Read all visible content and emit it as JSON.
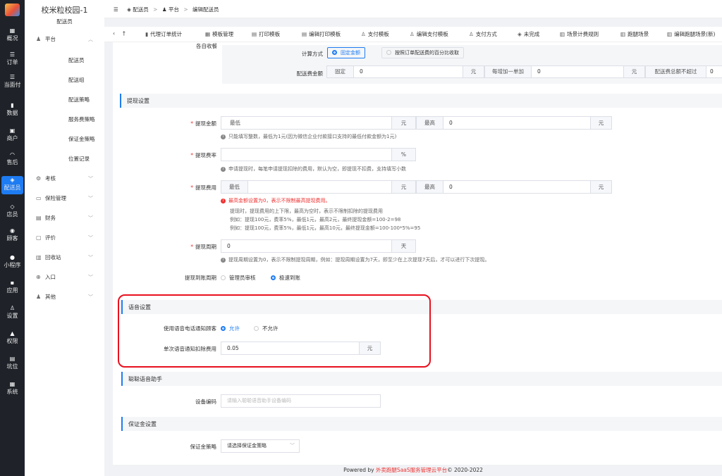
{
  "leftnav": {
    "items": [
      {
        "icon": "grid-icon",
        "glyph": "▦",
        "label": "概况"
      },
      {
        "icon": "list-icon",
        "glyph": "☰",
        "label": "订单"
      },
      {
        "icon": "pay-icon",
        "glyph": "☰",
        "label": "当面付"
      },
      {
        "icon": "bar-chart-icon",
        "glyph": "▮",
        "label": "数据"
      },
      {
        "icon": "store-icon",
        "glyph": "▣",
        "label": "商户"
      },
      {
        "icon": "headset-icon",
        "glyph": "◠",
        "label": "售后"
      },
      {
        "icon": "courier-icon",
        "glyph": "◈",
        "label": "配送员"
      },
      {
        "icon": "shop-icon",
        "glyph": "◇",
        "label": "店员"
      },
      {
        "icon": "customer-icon",
        "glyph": "◉",
        "label": "顾客"
      },
      {
        "icon": "mini-program-icon",
        "glyph": "●",
        "label": "小程序"
      },
      {
        "icon": "apps-icon",
        "glyph": "▪",
        "label": "应用"
      },
      {
        "icon": "settings-icon",
        "glyph": "♙",
        "label": "设置"
      },
      {
        "icon": "lock-icon",
        "glyph": "▲",
        "label": "权限"
      },
      {
        "icon": "document-icon",
        "glyph": "▤",
        "label": "坑位"
      },
      {
        "icon": "windows-icon",
        "glyph": "▦",
        "label": "系统"
      }
    ]
  },
  "sidebar": {
    "school": "校米粒校园-1",
    "role": "配送员",
    "platform": "平台",
    "sub_items": [
      "配送员",
      "配送组",
      "配送策略",
      "服务费策略",
      "保证金策略",
      "位置记录"
    ],
    "groups": [
      "考核",
      "保险管理",
      "财务",
      "评价",
      "回收站",
      "入口",
      "其他"
    ]
  },
  "breadcrumb": {
    "items": [
      "配送员",
      "平台",
      "编辑配送员"
    ]
  },
  "tabs": [
    "代理订单统计",
    "模板管理",
    "打印模板",
    "编辑打印模板",
    "支付模板",
    "编辑支付模板",
    "支付方式",
    "未完成",
    "场景计费规则",
    "跑腿场景",
    "编辑跑腿场景(新)"
  ],
  "collect": {
    "label": "各自收餐",
    "calc_label": "计算方式",
    "option_fixed": "固定金额",
    "option_percent": "按照订单配送费的百分比收取",
    "fee_label": "配送费金额",
    "fixed_label": "固定",
    "fixed_value": "0",
    "unit": "元",
    "per_order_label": "每增加一单加",
    "per_order_value": "0",
    "cap_label": "配送费总额不超过",
    "cap_value": "0"
  },
  "withdraw": {
    "section_title": "提现设置",
    "amount_label": "提现金额",
    "min_label": "最低",
    "max_label": "最高",
    "max_value": "0",
    "unit": "元",
    "amount_hint": "只能填写整数，最低为1元(因为微信企业付款接口支持的最低付款金额为1元)",
    "rate_label": "提现费率",
    "rate_unit": "%",
    "rate_hint": "申请提现时，每笔申请提现扣除的费用，默认为空，即提现不扣费，支持填写小数",
    "fee_label": "提现费用",
    "fee_max_value": "0",
    "fee_hint_red": "最高金额设置为0，表示不限制最高提现费用。",
    "fee_hint_1": "提现时，提现费用的上下限，最高为空时，表示不限制扣除的提现费用",
    "fee_hint_2": "例如：提现100元，费率5%，最低1元，最高2元，最终提现金额=100-2=98",
    "fee_hint_3": "例如：提现100元，费率5%，最低1元，最高10元，最终提现金额=100-100*5%=95",
    "period_label": "提现周期",
    "period_value": "0",
    "period_unit": "天",
    "period_hint": "提现周期设置为0，表示不限制提现周期，例如：提现周期设置为7天，即至少在上次提现7天后，才可以进行下次提现。",
    "arrival_label": "提现到账周期",
    "arrival_manual": "管理员审核",
    "arrival_fast": "极速到账"
  },
  "voice": {
    "section_title": "语音设置",
    "notify_label": "使用语音电话通知顾客",
    "allow": "允许",
    "deny": "不允许",
    "deduct_label": "单次语音通知扣除费用",
    "deduct_value": "0.05",
    "unit": "元"
  },
  "assistant": {
    "section_title": "聪聪语音助手",
    "device_label": "设备编码",
    "device_placeholder": "请输入聪聪语音助手设备编码"
  },
  "deposit": {
    "section_title": "保证金设置",
    "policy_label": "保证金策略",
    "policy_placeholder": "请选择保证金策略"
  },
  "footer": {
    "prefix": "Powered by ",
    "brand": "外卖跑腿SaaS服务管理云平台",
    "suffix": "© 2020-2022"
  },
  "colors": {
    "accent": "#1e7cf2",
    "highlight": "#e8101f",
    "nav_bg": "#1f2329"
  }
}
